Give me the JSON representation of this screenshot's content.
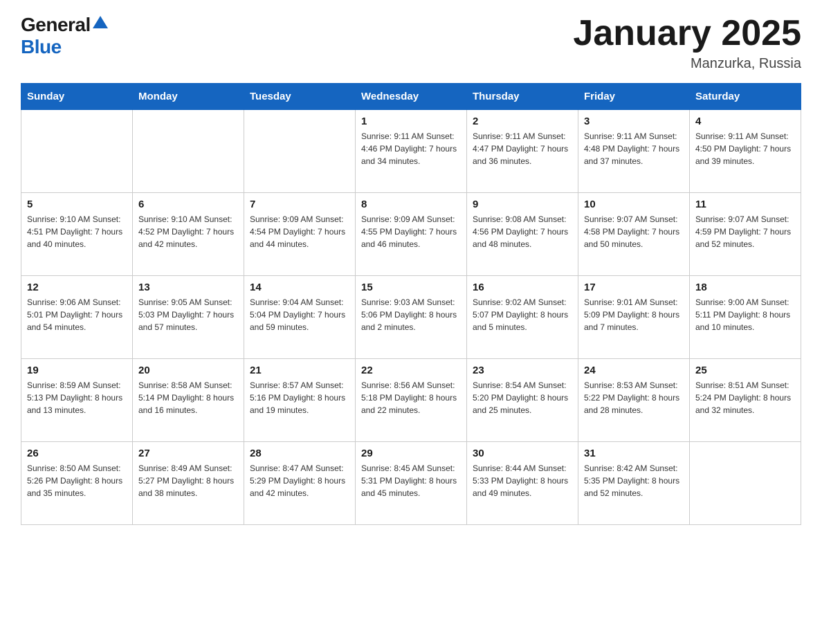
{
  "header": {
    "logo_general": "General",
    "logo_blue": "Blue",
    "title": "January 2025",
    "location": "Manzurka, Russia"
  },
  "calendar": {
    "days_of_week": [
      "Sunday",
      "Monday",
      "Tuesday",
      "Wednesday",
      "Thursday",
      "Friday",
      "Saturday"
    ],
    "weeks": [
      [
        {
          "day": "",
          "info": ""
        },
        {
          "day": "",
          "info": ""
        },
        {
          "day": "",
          "info": ""
        },
        {
          "day": "1",
          "info": "Sunrise: 9:11 AM\nSunset: 4:46 PM\nDaylight: 7 hours\nand 34 minutes."
        },
        {
          "day": "2",
          "info": "Sunrise: 9:11 AM\nSunset: 4:47 PM\nDaylight: 7 hours\nand 36 minutes."
        },
        {
          "day": "3",
          "info": "Sunrise: 9:11 AM\nSunset: 4:48 PM\nDaylight: 7 hours\nand 37 minutes."
        },
        {
          "day": "4",
          "info": "Sunrise: 9:11 AM\nSunset: 4:50 PM\nDaylight: 7 hours\nand 39 minutes."
        }
      ],
      [
        {
          "day": "5",
          "info": "Sunrise: 9:10 AM\nSunset: 4:51 PM\nDaylight: 7 hours\nand 40 minutes."
        },
        {
          "day": "6",
          "info": "Sunrise: 9:10 AM\nSunset: 4:52 PM\nDaylight: 7 hours\nand 42 minutes."
        },
        {
          "day": "7",
          "info": "Sunrise: 9:09 AM\nSunset: 4:54 PM\nDaylight: 7 hours\nand 44 minutes."
        },
        {
          "day": "8",
          "info": "Sunrise: 9:09 AM\nSunset: 4:55 PM\nDaylight: 7 hours\nand 46 minutes."
        },
        {
          "day": "9",
          "info": "Sunrise: 9:08 AM\nSunset: 4:56 PM\nDaylight: 7 hours\nand 48 minutes."
        },
        {
          "day": "10",
          "info": "Sunrise: 9:07 AM\nSunset: 4:58 PM\nDaylight: 7 hours\nand 50 minutes."
        },
        {
          "day": "11",
          "info": "Sunrise: 9:07 AM\nSunset: 4:59 PM\nDaylight: 7 hours\nand 52 minutes."
        }
      ],
      [
        {
          "day": "12",
          "info": "Sunrise: 9:06 AM\nSunset: 5:01 PM\nDaylight: 7 hours\nand 54 minutes."
        },
        {
          "day": "13",
          "info": "Sunrise: 9:05 AM\nSunset: 5:03 PM\nDaylight: 7 hours\nand 57 minutes."
        },
        {
          "day": "14",
          "info": "Sunrise: 9:04 AM\nSunset: 5:04 PM\nDaylight: 7 hours\nand 59 minutes."
        },
        {
          "day": "15",
          "info": "Sunrise: 9:03 AM\nSunset: 5:06 PM\nDaylight: 8 hours\nand 2 minutes."
        },
        {
          "day": "16",
          "info": "Sunrise: 9:02 AM\nSunset: 5:07 PM\nDaylight: 8 hours\nand 5 minutes."
        },
        {
          "day": "17",
          "info": "Sunrise: 9:01 AM\nSunset: 5:09 PM\nDaylight: 8 hours\nand 7 minutes."
        },
        {
          "day": "18",
          "info": "Sunrise: 9:00 AM\nSunset: 5:11 PM\nDaylight: 8 hours\nand 10 minutes."
        }
      ],
      [
        {
          "day": "19",
          "info": "Sunrise: 8:59 AM\nSunset: 5:13 PM\nDaylight: 8 hours\nand 13 minutes."
        },
        {
          "day": "20",
          "info": "Sunrise: 8:58 AM\nSunset: 5:14 PM\nDaylight: 8 hours\nand 16 minutes."
        },
        {
          "day": "21",
          "info": "Sunrise: 8:57 AM\nSunset: 5:16 PM\nDaylight: 8 hours\nand 19 minutes."
        },
        {
          "day": "22",
          "info": "Sunrise: 8:56 AM\nSunset: 5:18 PM\nDaylight: 8 hours\nand 22 minutes."
        },
        {
          "day": "23",
          "info": "Sunrise: 8:54 AM\nSunset: 5:20 PM\nDaylight: 8 hours\nand 25 minutes."
        },
        {
          "day": "24",
          "info": "Sunrise: 8:53 AM\nSunset: 5:22 PM\nDaylight: 8 hours\nand 28 minutes."
        },
        {
          "day": "25",
          "info": "Sunrise: 8:51 AM\nSunset: 5:24 PM\nDaylight: 8 hours\nand 32 minutes."
        }
      ],
      [
        {
          "day": "26",
          "info": "Sunrise: 8:50 AM\nSunset: 5:26 PM\nDaylight: 8 hours\nand 35 minutes."
        },
        {
          "day": "27",
          "info": "Sunrise: 8:49 AM\nSunset: 5:27 PM\nDaylight: 8 hours\nand 38 minutes."
        },
        {
          "day": "28",
          "info": "Sunrise: 8:47 AM\nSunset: 5:29 PM\nDaylight: 8 hours\nand 42 minutes."
        },
        {
          "day": "29",
          "info": "Sunrise: 8:45 AM\nSunset: 5:31 PM\nDaylight: 8 hours\nand 45 minutes."
        },
        {
          "day": "30",
          "info": "Sunrise: 8:44 AM\nSunset: 5:33 PM\nDaylight: 8 hours\nand 49 minutes."
        },
        {
          "day": "31",
          "info": "Sunrise: 8:42 AM\nSunset: 5:35 PM\nDaylight: 8 hours\nand 52 minutes."
        },
        {
          "day": "",
          "info": ""
        }
      ]
    ]
  }
}
